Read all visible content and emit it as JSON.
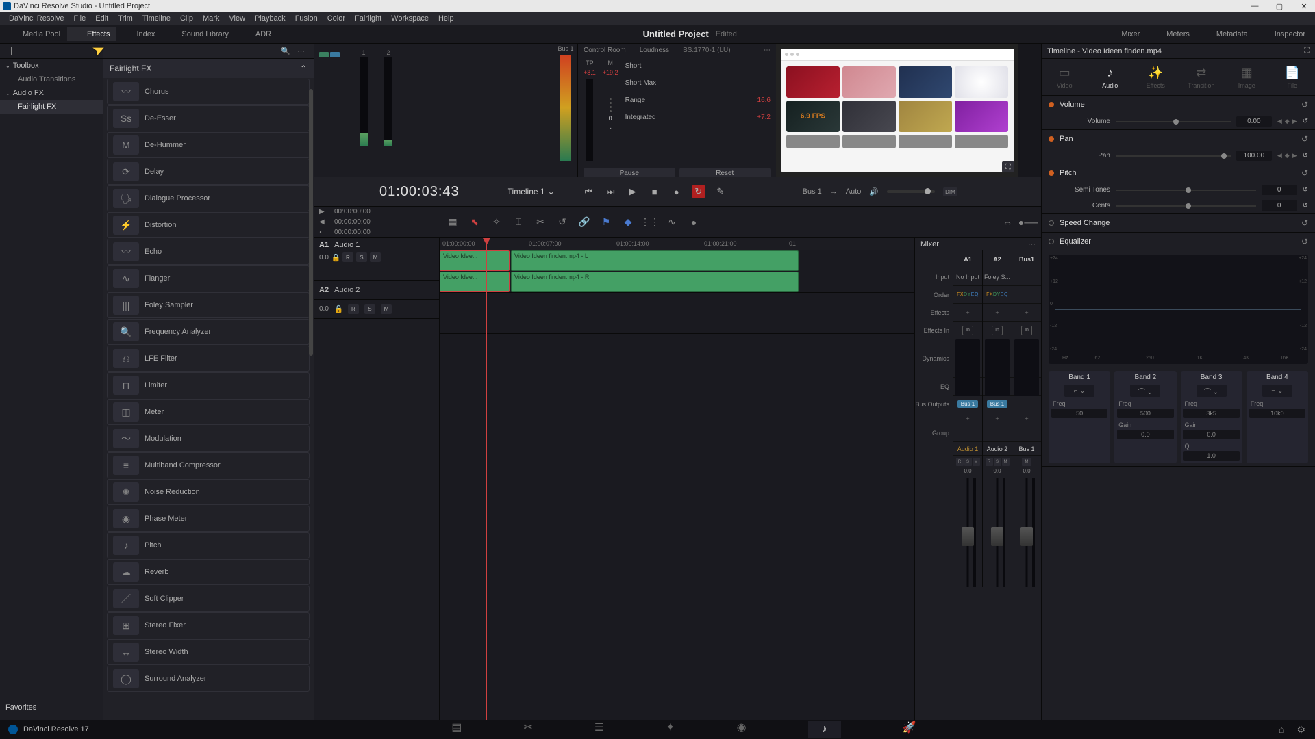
{
  "titlebar": {
    "text": "DaVinci Resolve Studio - Untitled Project"
  },
  "menubar": [
    "DaVinci Resolve",
    "File",
    "Edit",
    "Trim",
    "Timeline",
    "Clip",
    "Mark",
    "View",
    "Playback",
    "Fusion",
    "Color",
    "Fairlight",
    "Workspace",
    "Help"
  ],
  "toolrow": {
    "left": [
      {
        "id": "media-pool",
        "label": "Media Pool"
      },
      {
        "id": "effects",
        "label": "Effects",
        "active": true
      },
      {
        "id": "index",
        "label": "Index"
      },
      {
        "id": "sound-library",
        "label": "Sound Library"
      },
      {
        "id": "adr",
        "label": "ADR"
      }
    ],
    "project_title": "Untitled Project",
    "edited": "Edited",
    "right": [
      {
        "id": "mixer",
        "label": "Mixer"
      },
      {
        "id": "meters",
        "label": "Meters"
      },
      {
        "id": "metadata",
        "label": "Metadata"
      },
      {
        "id": "inspector",
        "label": "Inspector"
      }
    ]
  },
  "sidebar": {
    "toolbox": "Toolbox",
    "audio_transitions": "Audio Transitions",
    "audio_fx": "Audio FX",
    "fairlight_fx": "Fairlight FX",
    "favorites": "Favorites"
  },
  "fx": {
    "header": "Fairlight FX",
    "items": [
      "Chorus",
      "De-Esser",
      "De-Hummer",
      "Delay",
      "Dialogue Processor",
      "Distortion",
      "Echo",
      "Flanger",
      "Foley Sampler",
      "Frequency Analyzer",
      "LFE Filter",
      "Limiter",
      "Meter",
      "Modulation",
      "Multiband Compressor",
      "Noise Reduction",
      "Phase Meter",
      "Pitch",
      "Reverb",
      "Soft Clipper",
      "Stereo Fixer",
      "Stereo Width",
      "Surround Analyzer"
    ]
  },
  "mini_mixer": {
    "ch": [
      "1",
      "2"
    ],
    "bus_label": "Bus 1"
  },
  "loudness": {
    "control_room": "Control Room",
    "title": "Loudness",
    "standard": "BS.1770-1 (LU)",
    "tp_label": "TP",
    "tp_val": "+8.1",
    "m_label": "M",
    "m_val": "+19.2",
    "m_zero": "0",
    "stats": [
      {
        "label": "Short",
        "val": ""
      },
      {
        "label": "Short Max",
        "val": ""
      },
      {
        "label": "Range",
        "val": "16.6"
      },
      {
        "label": "Integrated",
        "val": "+7.2"
      }
    ],
    "pause": "Pause",
    "reset": "Reset"
  },
  "preview": {
    "fps_text": "6.9 FPS"
  },
  "transport": {
    "timecode": "01:00:03:43",
    "timeline_name": "Timeline 1",
    "tc_rows": [
      "00:00:00:00",
      "00:00:00:00",
      "00:00:00:00"
    ],
    "bus": "Bus 1",
    "auto": "Auto",
    "dim": "DIM"
  },
  "ruler": [
    "01:00:00:00",
    "01:00:07:00",
    "01:00:14:00",
    "01:00:21:00",
    "01"
  ],
  "tracks": {
    "a1": {
      "id": "A1",
      "name": "Audio 1",
      "val": "0.0"
    },
    "a2": {
      "id": "A2",
      "name": "Audio 2",
      "val": "0.0"
    },
    "clip1a": "Video Idee...",
    "clip1b": "Video Ideen finden.mp4 - L",
    "clip2a": "Video Idee...",
    "clip2b": "Video Ideen finden.mp4 - R"
  },
  "mixer": {
    "title": "Mixer",
    "labels": [
      "Input",
      "Order",
      "Effects",
      "Effects In",
      "Dynamics",
      "EQ",
      "Bus Outputs",
      "Group"
    ],
    "channels": [
      {
        "hdr": "A1",
        "input": "No Input",
        "name": "Audio 1",
        "bus": "Bus 1",
        "db": "0.0",
        "nameclass": ""
      },
      {
        "hdr": "A2",
        "input": "Foley S...",
        "name": "Audio 2",
        "bus": "Bus 1",
        "db": "0.0",
        "nameclass": "a2"
      },
      {
        "hdr": "Bus1",
        "input": "",
        "name": "Bus 1",
        "bus": "",
        "db": "0.0",
        "nameclass": "a2"
      }
    ],
    "fxdy": "FX DY EQ",
    "plus": "+",
    "in": "In"
  },
  "inspector": {
    "title": "Timeline - Video Ideen finden.mp4",
    "tabs": [
      {
        "id": "video",
        "label": "Video"
      },
      {
        "id": "audio",
        "label": "Audio",
        "active": true
      },
      {
        "id": "effects",
        "label": "Effects"
      },
      {
        "id": "transition",
        "label": "Transition"
      },
      {
        "id": "image",
        "label": "Image"
      },
      {
        "id": "file",
        "label": "File"
      }
    ],
    "volume": {
      "title": "Volume",
      "label": "Volume",
      "val": "0.00"
    },
    "pan": {
      "title": "Pan",
      "label": "Pan",
      "val": "100.00"
    },
    "pitch": {
      "title": "Pitch",
      "semi": "Semi Tones",
      "semi_val": "0",
      "cents": "Cents",
      "cents_val": "0"
    },
    "speed": {
      "title": "Speed Change"
    },
    "eq": {
      "title": "Equalizer",
      "scale_l": [
        "+24",
        "+12",
        "0",
        "-12",
        "-24"
      ],
      "scale_b": [
        "Hz",
        "62",
        "250",
        "1K",
        "4K",
        "16K"
      ],
      "bands": [
        {
          "name": "Band 1",
          "freq_l": "Freq",
          "freq": "50"
        },
        {
          "name": "Band 2",
          "freq_l": "Freq",
          "freq": "500",
          "gain_l": "Gain",
          "gain": "0.0"
        },
        {
          "name": "Band 3",
          "freq_l": "Freq",
          "freq": "3k5",
          "gain_l": "Gain",
          "gain": "0.0",
          "q_l": "Q",
          "q": "1.0"
        },
        {
          "name": "Band 4",
          "freq_l": "Freq",
          "freq": "10k0"
        }
      ]
    }
  },
  "bottom": {
    "version": "DaVinci Resolve 17"
  }
}
